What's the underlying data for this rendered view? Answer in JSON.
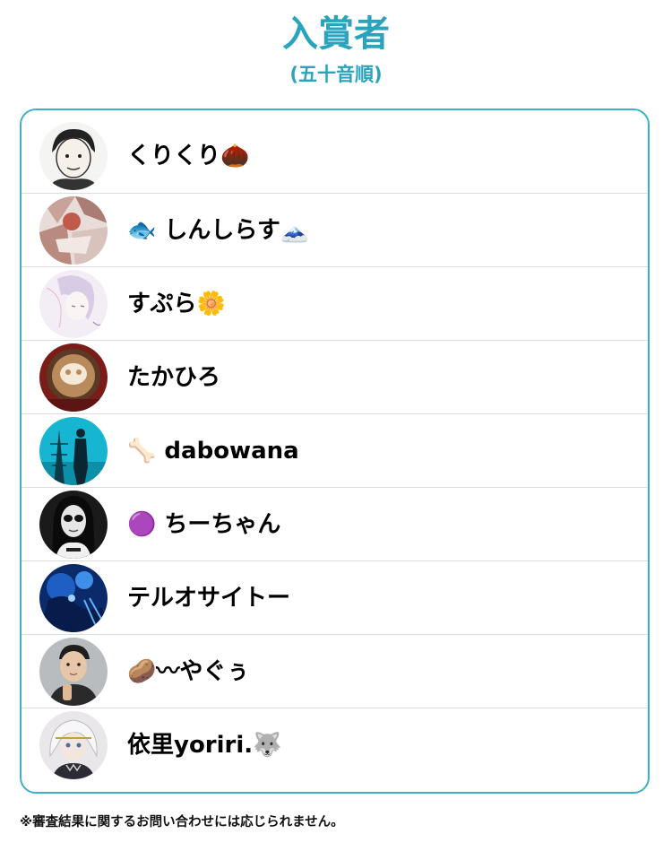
{
  "header": {
    "title": "入賞者",
    "subtitle": "(五十音順)"
  },
  "winners": [
    {
      "name": "くりくり🌰",
      "avatar_icon": "sketch-portrait-avatar"
    },
    {
      "name": "🐟 しんしらす🗻",
      "avatar_icon": "collage-photo-avatar"
    },
    {
      "name": "すぷら🌼",
      "avatar_icon": "illustration-girl-avatar"
    },
    {
      "name": "たかひろ",
      "avatar_icon": "latte-art-avatar"
    },
    {
      "name": "🦴 dabowana",
      "avatar_icon": "silhouette-tower-avatar"
    },
    {
      "name": "🟣 ちーちゃん",
      "avatar_icon": "sunglasses-woman-avatar"
    },
    {
      "name": "テルオサイトー",
      "avatar_icon": "blue-stage-avatar"
    },
    {
      "name": "🥔〰やぐぅ",
      "avatar_icon": "man-portrait-avatar"
    },
    {
      "name": "依里yoriri.🐺",
      "avatar_icon": "anime-character-avatar"
    }
  ],
  "footer": {
    "note": "※審査結果に関するお問い合わせには応じられません。"
  },
  "colors": {
    "accent": "#2aa3bd",
    "card_border": "#3cb0c8",
    "divider": "#dcdcdc"
  }
}
